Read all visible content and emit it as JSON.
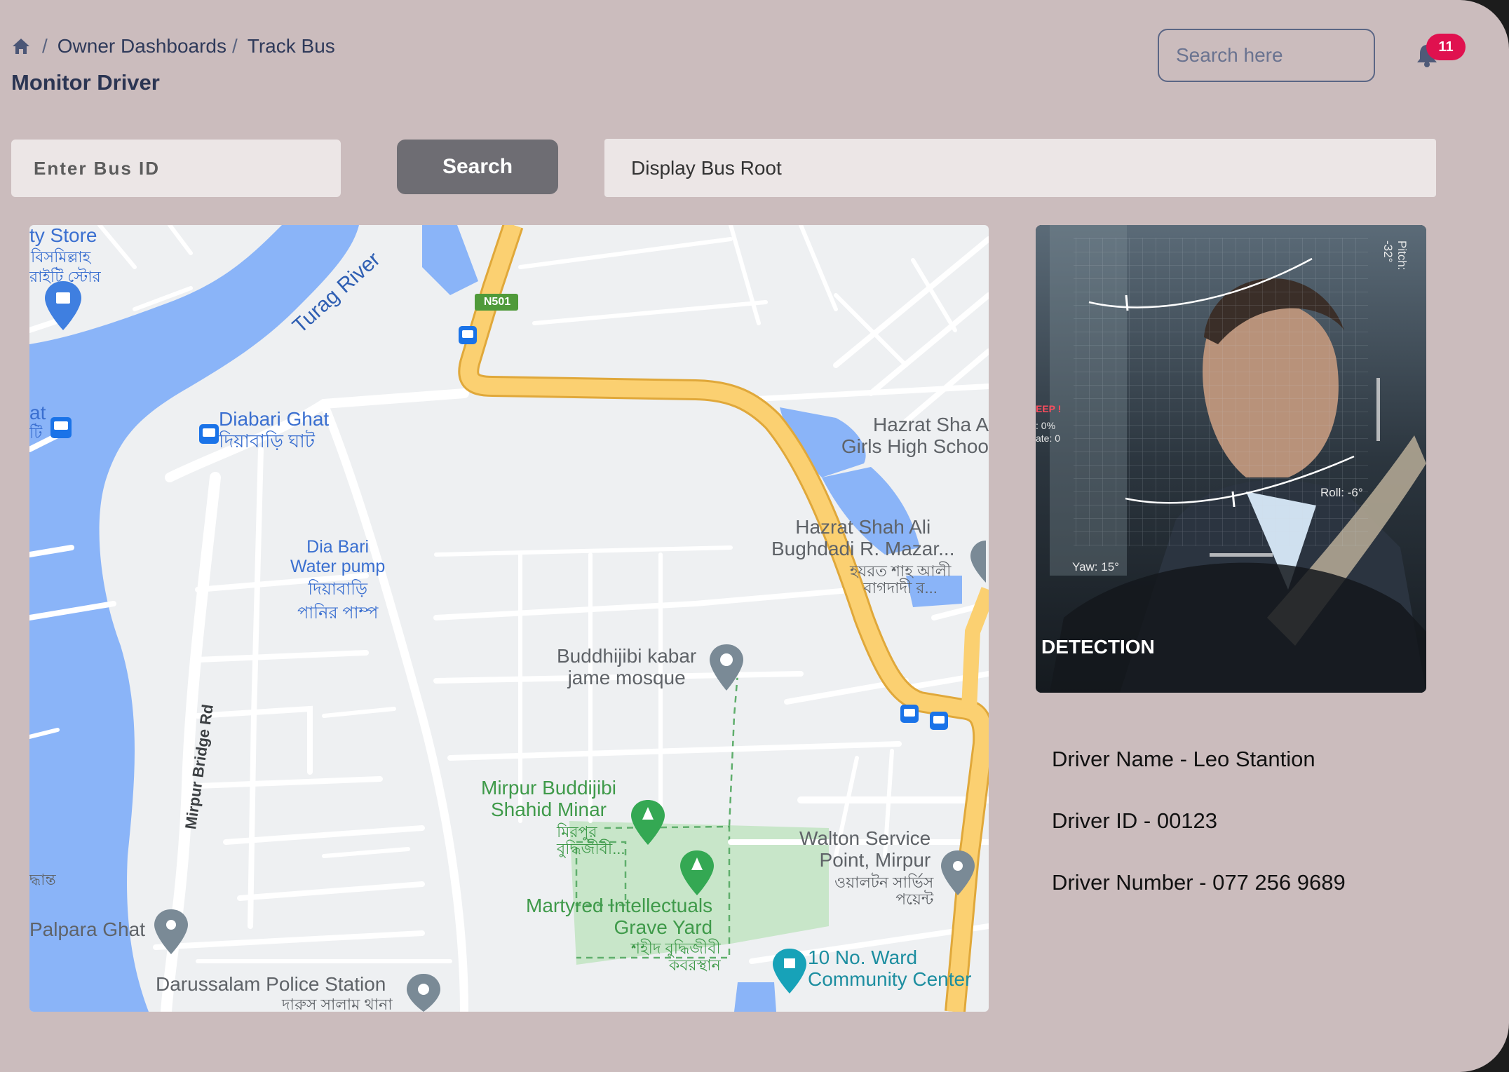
{
  "breadcrumb": {
    "items": [
      "Owner Dashboards",
      "Track Bus"
    ]
  },
  "page_title": "Monitor Driver",
  "header": {
    "search_placeholder": "Search here",
    "notification_count": "11"
  },
  "controls": {
    "bus_id_placeholder": "Enter Bus ID",
    "search_label": "Search",
    "root_display": "Display Bus Root"
  },
  "map": {
    "labels": {
      "store": "ty Store",
      "store_bn1": "বিসমিল্লাহ",
      "store_bn2": "রাইটি স্টোর",
      "river": "Turag River",
      "road_badge": "N501",
      "ghat_left": "at",
      "ghat_left_bn": "টি",
      "diabari_ghat": "Diabari Ghat",
      "diabari_ghat_bn": "দিয়াবাড়ি ঘাট",
      "water_pump": "Dia Bari\nWater pump",
      "water_pump_bn": "দিয়াবাড়ি\nপানির পাম্প",
      "school": "Hazrat Sha A\nGirls High Schoo",
      "mazar": "Hazrat Shah Ali\nBughdadi R. Mazar...",
      "mazar_bn": "হযরত শাহ আলী\nবাগদাদী র...",
      "mosque": "Buddhijibi kabar\njame mosque",
      "road": "Mirpur Bridge Rd",
      "minar": "Mirpur Buddijibi\nShahid Minar",
      "minar_bn": "মিরপুর\nবুদ্ধিজীবী...",
      "grave": "Martyred Intellectuals\nGrave Yard",
      "grave_bn": "শহীদ বুদ্ধিজীবী\nকবরস্থান",
      "walton": "Walton Service\nPoint, Mirpur",
      "walton_bn": "ওয়ালটন সার্ভিস\nপয়েন্ট",
      "palpara": "Palpara Ghat",
      "palpara_bn_left": "দ্ধান্ত",
      "police": "Darussalam Police Station",
      "police_bn": "দারুস সালাম থানা",
      "ward": "10 No. Ward\nCommunity Center"
    }
  },
  "detection": {
    "label": "DETECTION",
    "pitch": "Pitch: -32°",
    "roll": "Roll: -6°",
    "yaw": "Yaw: 15°",
    "sleep_alert": "EEP !",
    "stat1": ": 0%",
    "stat2": "ate: 0"
  },
  "driver": {
    "name": "Driver Name - Leo Stantion",
    "id": "Driver ID - 00123",
    "number": "Driver Number - 077 256 9689"
  },
  "colors": {
    "background": "#cbbcbd",
    "badge": "#e0114f",
    "water": "#8ab4f8",
    "highway": "#fbc75a",
    "park": "#c8e6c9"
  }
}
